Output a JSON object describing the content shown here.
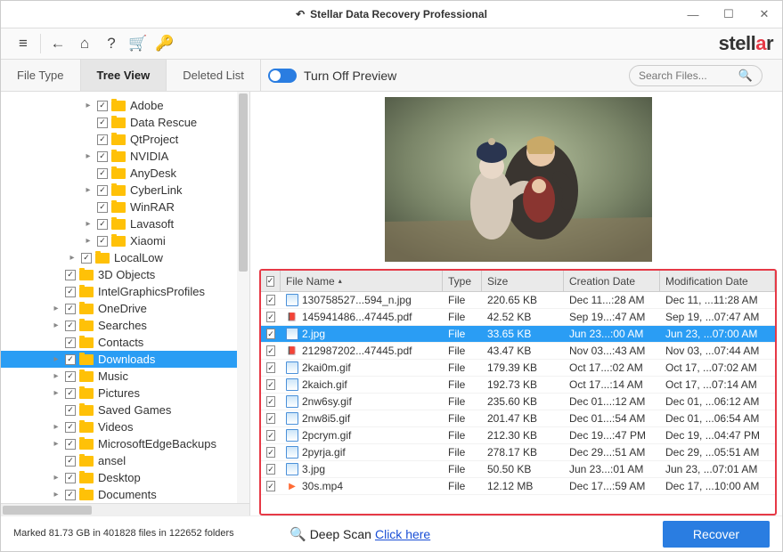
{
  "window": {
    "title": "Stellar Data Recovery Professional"
  },
  "brand_text": "stellar",
  "tabs": {
    "fileType": "File Type",
    "treeView": "Tree View",
    "deletedList": "Deleted List",
    "active": "treeView"
  },
  "preview": {
    "toggle_label": "Turn Off Preview",
    "enabled": true
  },
  "search": {
    "placeholder": "Search Files..."
  },
  "tree": [
    {
      "label": "Adobe",
      "depth": 4,
      "checked": true,
      "exp": "collapsed"
    },
    {
      "label": "Data Rescue",
      "depth": 4,
      "checked": true,
      "exp": "none"
    },
    {
      "label": "QtProject",
      "depth": 4,
      "checked": true,
      "exp": "none"
    },
    {
      "label": "NVIDIA",
      "depth": 4,
      "checked": true,
      "exp": "collapsed"
    },
    {
      "label": "AnyDesk",
      "depth": 4,
      "checked": true,
      "exp": "none"
    },
    {
      "label": "CyberLink",
      "depth": 4,
      "checked": true,
      "exp": "collapsed"
    },
    {
      "label": "WinRAR",
      "depth": 4,
      "checked": true,
      "exp": "none"
    },
    {
      "label": "Lavasoft",
      "depth": 4,
      "checked": true,
      "exp": "collapsed"
    },
    {
      "label": "Xiaomi",
      "depth": 4,
      "checked": true,
      "exp": "collapsed"
    },
    {
      "label": "LocalLow",
      "depth": 3,
      "checked": true,
      "exp": "collapsed"
    },
    {
      "label": "3D Objects",
      "depth": 2,
      "checked": true,
      "exp": "none"
    },
    {
      "label": "IntelGraphicsProfiles",
      "depth": 2,
      "checked": true,
      "exp": "none"
    },
    {
      "label": "OneDrive",
      "depth": 2,
      "checked": true,
      "exp": "collapsed"
    },
    {
      "label": "Searches",
      "depth": 2,
      "checked": true,
      "exp": "collapsed"
    },
    {
      "label": "Contacts",
      "depth": 2,
      "checked": true,
      "exp": "none"
    },
    {
      "label": "Downloads",
      "depth": 2,
      "checked": true,
      "exp": "collapsed",
      "sel": true
    },
    {
      "label": "Music",
      "depth": 2,
      "checked": true,
      "exp": "collapsed"
    },
    {
      "label": "Pictures",
      "depth": 2,
      "checked": true,
      "exp": "collapsed"
    },
    {
      "label": "Saved Games",
      "depth": 2,
      "checked": true,
      "exp": "none"
    },
    {
      "label": "Videos",
      "depth": 2,
      "checked": true,
      "exp": "collapsed"
    },
    {
      "label": "MicrosoftEdgeBackups",
      "depth": 2,
      "checked": true,
      "exp": "collapsed"
    },
    {
      "label": "ansel",
      "depth": 2,
      "checked": true,
      "exp": "none"
    },
    {
      "label": "Desktop",
      "depth": 2,
      "checked": true,
      "exp": "collapsed"
    },
    {
      "label": "Documents",
      "depth": 2,
      "checked": true,
      "exp": "collapsed"
    }
  ],
  "grid": {
    "headers": {
      "name": "File Name",
      "type": "Type",
      "size": "Size",
      "cdate": "Creation Date",
      "mdate": "Modification Date"
    },
    "sort": {
      "column": "name",
      "dir": "asc"
    },
    "rows": [
      {
        "checked": true,
        "icon": "img",
        "name": "130758527...594_n.jpg",
        "type": "File",
        "size": "220.65 KB",
        "cdate": "Dec 11...:28 AM",
        "mdate": "Dec 11, ...11:28 AM"
      },
      {
        "checked": true,
        "icon": "pdf",
        "name": "145941486...47445.pdf",
        "type": "File",
        "size": "42.52 KB",
        "cdate": "Sep 19...:47 AM",
        "mdate": "Sep 19, ...07:47 AM"
      },
      {
        "checked": true,
        "icon": "img",
        "name": "2.jpg",
        "type": "File",
        "size": "33.65 KB",
        "cdate": "Jun 23...:00 AM",
        "mdate": "Jun 23, ...07:00 AM",
        "sel": true
      },
      {
        "checked": true,
        "icon": "pdf",
        "name": "212987202...47445.pdf",
        "type": "File",
        "size": "43.47 KB",
        "cdate": "Nov 03...:43 AM",
        "mdate": "Nov 03, ...07:44 AM"
      },
      {
        "checked": true,
        "icon": "img",
        "name": "2kai0m.gif",
        "type": "File",
        "size": "179.39 KB",
        "cdate": "Oct 17...:02 AM",
        "mdate": "Oct 17, ...07:02 AM"
      },
      {
        "checked": true,
        "icon": "img",
        "name": "2kaich.gif",
        "type": "File",
        "size": "192.73 KB",
        "cdate": "Oct 17...:14 AM",
        "mdate": "Oct 17, ...07:14 AM"
      },
      {
        "checked": true,
        "icon": "img",
        "name": "2nw6sy.gif",
        "type": "File",
        "size": "235.60 KB",
        "cdate": "Dec 01...:12 AM",
        "mdate": "Dec 01, ...06:12 AM"
      },
      {
        "checked": true,
        "icon": "img",
        "name": "2nw8i5.gif",
        "type": "File",
        "size": "201.47 KB",
        "cdate": "Dec 01...:54 AM",
        "mdate": "Dec 01, ...06:54 AM"
      },
      {
        "checked": true,
        "icon": "img",
        "name": "2pcrym.gif",
        "type": "File",
        "size": "212.30 KB",
        "cdate": "Dec 19...:47 PM",
        "mdate": "Dec 19, ...04:47 PM"
      },
      {
        "checked": true,
        "icon": "img",
        "name": "2pyrja.gif",
        "type": "File",
        "size": "278.17 KB",
        "cdate": "Dec 29...:51 AM",
        "mdate": "Dec 29, ...05:51 AM"
      },
      {
        "checked": true,
        "icon": "img",
        "name": "3.jpg",
        "type": "File",
        "size": "50.50 KB",
        "cdate": "Jun 23...:01 AM",
        "mdate": "Jun 23, ...07:01 AM"
      },
      {
        "checked": true,
        "icon": "vid",
        "name": "30s.mp4",
        "type": "File",
        "size": "12.12 MB",
        "cdate": "Dec 17...:59 AM",
        "mdate": "Dec 17, ...10:00 AM"
      }
    ]
  },
  "footer": {
    "marked": "Marked 81.73 GB in 401828 files in 122652 folders",
    "deepscan_label": "Deep Scan",
    "deepscan_link": "Click here",
    "recover_label": "Recover"
  }
}
